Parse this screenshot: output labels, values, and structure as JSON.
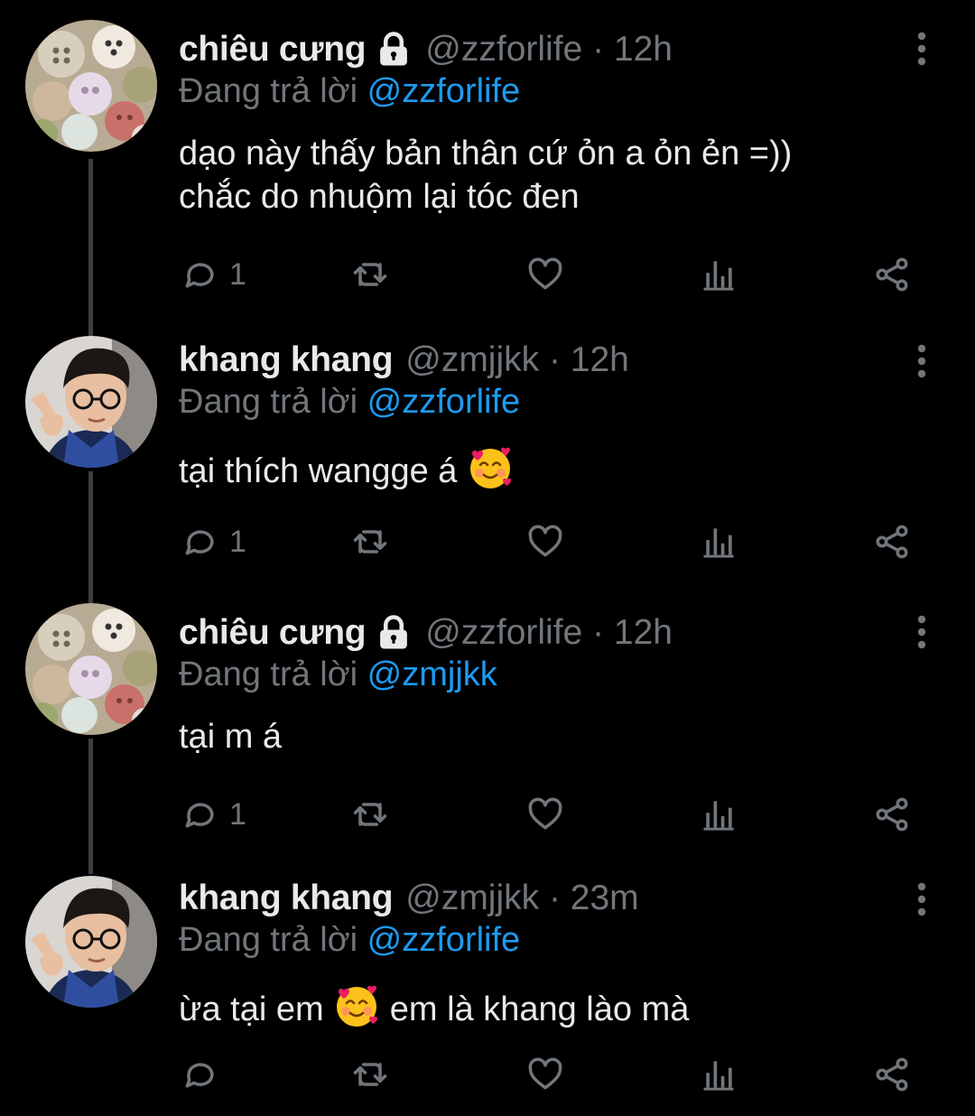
{
  "colors": {
    "background": "#000000",
    "text": "#e7e9ea",
    "secondary": "#71767b",
    "mention": "#1d9bf0",
    "thread_line": "#3a3f44"
  },
  "tweets": [
    {
      "name": "chiêu cưng",
      "protected": true,
      "handle_time": "@zzforlife · 12h",
      "replying_prefix": "Đang trả lời",
      "replying_to": "@zzforlife",
      "text_line1": "dạo này thấy bản thân cứ ỏn a ỏn ẻn =))",
      "text_line2": "chắc do nhuộm lại tóc đen",
      "reply_count": "1",
      "avatar": "buttons-avatar"
    },
    {
      "name": "khang khang",
      "protected": false,
      "handle_time": "@zmjjkk · 12h",
      "replying_prefix": "Đang trả lời",
      "replying_to": "@zzforlife",
      "text_before": "tại thích wangge á",
      "emoji": "smiling-face-with-hearts",
      "reply_count": "1",
      "avatar": "person-avatar"
    },
    {
      "name": "chiêu cưng",
      "protected": true,
      "handle_time": "@zzforlife · 12h",
      "replying_prefix": "Đang trả lời",
      "replying_to": "@zmjjkk",
      "text_line1": "tại m á",
      "reply_count": "1",
      "avatar": "buttons-avatar"
    },
    {
      "name": "khang khang",
      "protected": false,
      "handle_time": "@zmjjkk · 23m",
      "replying_prefix": "Đang trả lời",
      "replying_to": "@zzforlife",
      "text_before": "ừa tại em",
      "emoji": "smiling-face-with-hearts",
      "text_after": "em là khang lào mà",
      "reply_count": "",
      "avatar": "person-avatar"
    }
  ]
}
